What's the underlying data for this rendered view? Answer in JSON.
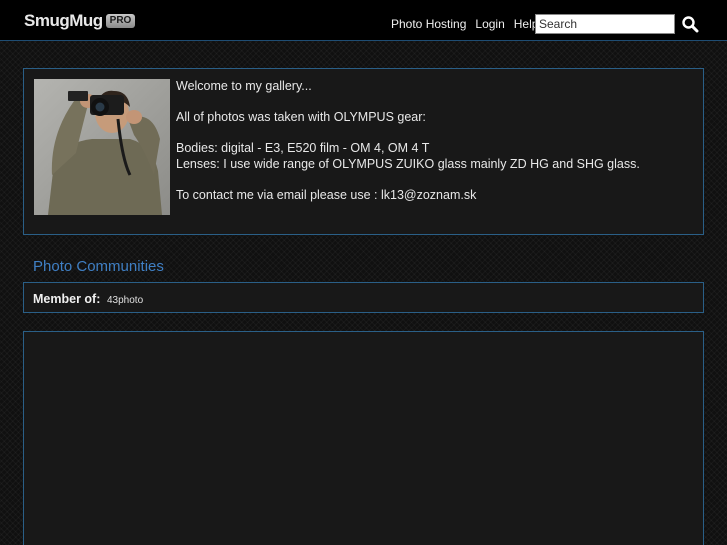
{
  "header": {
    "logo_text": "SmugMug",
    "logo_badge": "PRO",
    "nav": [
      "Photo Hosting",
      "Login",
      "Help"
    ],
    "search_placeholder": "Search",
    "search_icon": "magnifier-icon"
  },
  "intro": {
    "lines": [
      "Welcome to my gallery...",
      "",
      "All of photos was taken with OLYMPUS gear:",
      "",
      "Bodies: digital - E3, E520 film - OM 4, OM 4 T",
      "Lenses: I use wide range of OLYMPUS ZUIKO glass mainly ZD HG and SHG glass.",
      "",
      "To contact me via email please use : lk13@zoznam.sk"
    ]
  },
  "communities": {
    "title": "Photo Communities",
    "member_label": "Member of:",
    "member_value": "43photo"
  },
  "colors": {
    "accent_blue": "#3f7fc4",
    "panel_border": "#2a5f87",
    "panel_bg": "#181818",
    "header_bg": "#000000"
  }
}
